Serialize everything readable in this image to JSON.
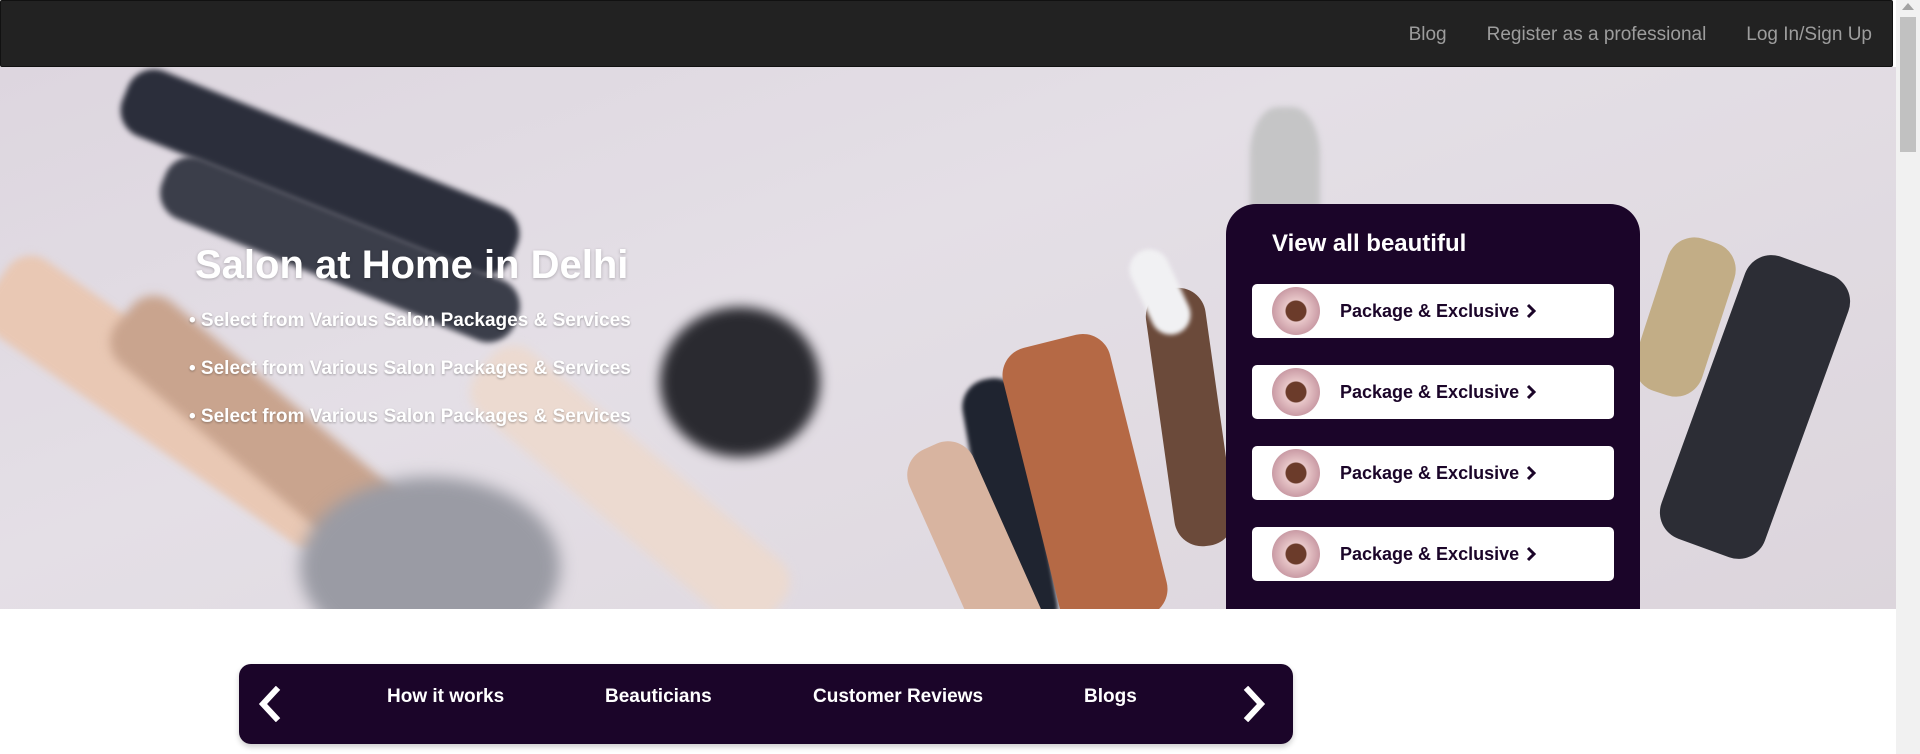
{
  "nav": {
    "blog": "Blog",
    "register": "Register as a professional",
    "login": "Log In/Sign Up"
  },
  "hero": {
    "title": "Salon at Home in Delhi",
    "bullets": [
      "• Select from Various Salon Packages & Services",
      "• Select from Various Salon Packages & Services",
      "• Select from Various Salon Packages & Services"
    ]
  },
  "panel": {
    "title": "View all beautiful",
    "items": [
      {
        "label": "Package & Exclusive"
      },
      {
        "label": "Package & Exclusive"
      },
      {
        "label": "Package & Exclusive"
      },
      {
        "label": "Package & Exclusive"
      }
    ]
  },
  "tabs": [
    "How it works",
    "Beauticians",
    "Customer Reviews",
    "Blogs"
  ],
  "colors": {
    "navbar": "#222222",
    "accent_dark_purple": "#1b0529",
    "nav_text": "#9d9d9d"
  },
  "icons": {
    "prev": "chevron-left-icon",
    "next": "chevron-right-icon",
    "item": "chevron-right-icon"
  }
}
